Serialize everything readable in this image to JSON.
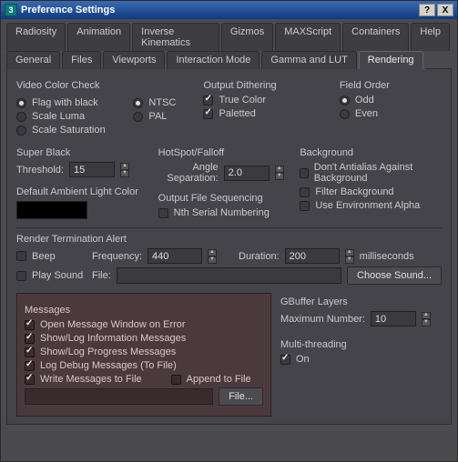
{
  "window": {
    "title": "Preference Settings",
    "help_btn": "?",
    "close_btn": "X",
    "app_badge": "3"
  },
  "tabs_row1": [
    "Radiosity",
    "Animation",
    "Inverse Kinematics",
    "Gizmos",
    "MAXScript",
    "Containers",
    "Help"
  ],
  "tabs_row2": [
    "General",
    "Files",
    "Viewports",
    "Interaction Mode",
    "Gamma and LUT",
    "Rendering"
  ],
  "active_tab": "Rendering",
  "groups": {
    "video_color_check": {
      "title": "Video Color Check",
      "flag_black": "Flag with black",
      "scale_luma": "Scale Luma",
      "scale_sat": "Scale Saturation",
      "ntsc": "NTSC",
      "pal": "PAL",
      "checked": "flag_black",
      "std_checked": "ntsc"
    },
    "output_dither": {
      "title": "Output Dithering",
      "true_color": "True Color",
      "paletted": "Paletted",
      "true_on": true,
      "pal_on": true
    },
    "field_order": {
      "title": "Field Order",
      "odd": "Odd",
      "even": "Even",
      "checked": "odd"
    },
    "super_black": {
      "title": "Super Black",
      "threshold_label": "Threshold:",
      "threshold": "15"
    },
    "hotspot": {
      "title": "HotSpot/Falloff",
      "angle_label": "Angle Separation:",
      "angle": "2.0"
    },
    "background": {
      "title": "Background",
      "no_aa": "Don't Antialias Against Background",
      "filter": "Filter Background",
      "env": "Use Environment Alpha"
    },
    "ambient": {
      "title": "Default Ambient Light Color",
      "color": "#000000"
    },
    "out_seq": {
      "title": "Output File Sequencing",
      "nth": "Nth Serial Numbering"
    },
    "render_term": {
      "title": "Render Termination Alert",
      "beep": "Beep",
      "freq_label": "Frequency:",
      "freq": "440",
      "dur_label": "Duration:",
      "dur": "200",
      "ms": "milliseconds",
      "play": "Play Sound",
      "file_label": "File:",
      "choose": "Choose Sound..."
    },
    "messages": {
      "title": "Messages",
      "open_err": "Open Message Window on Error",
      "show_info": "Show/Log Information Messages",
      "show_prog": "Show/Log Progress Messages",
      "log_debug": "Log Debug Messages (To File)",
      "write_file": "Write Messages to File",
      "append": "Append to File",
      "file_btn": "File..."
    },
    "gbuffer": {
      "title": "GBuffer Layers",
      "max_label": "Maximum Number:",
      "max": "10"
    },
    "multithread": {
      "title": "Multi-threading",
      "on": "On",
      "on_checked": true
    }
  }
}
